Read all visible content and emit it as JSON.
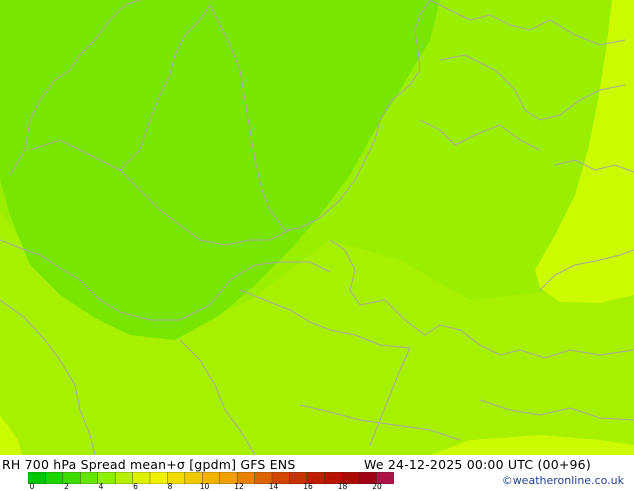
{
  "title": "RH 700 hPa Spread mean+σ [gpdm] GFS ENS",
  "valid_time": "We 24-12-2025 00:00 UTC (00+96)",
  "credit": "©weatheronline.co.uk",
  "colorbar": {
    "colors": [
      "#00c800",
      "#1ed200",
      "#3cdc00",
      "#64e600",
      "#8cf000",
      "#b4f000",
      "#dcf000",
      "#f0f000",
      "#f0dc00",
      "#f0c800",
      "#f0b400",
      "#f0a000",
      "#e68200",
      "#dc6400",
      "#d24600",
      "#c83200",
      "#be1e00",
      "#b41400",
      "#aa0a00",
      "#a00014",
      "#aa1446"
    ],
    "tick_labels": [
      "0",
      "2",
      "4",
      "6",
      "8",
      "10",
      "12",
      "14",
      "16",
      "18",
      "20"
    ]
  },
  "map": {
    "fill_colors": {
      "low_spread": "#78e600",
      "mid_spread": "#9aee00",
      "high_spread": "#b0f200",
      "highest_spread": "#ccfa00"
    },
    "coastline_color": "#a8a8a8"
  }
}
